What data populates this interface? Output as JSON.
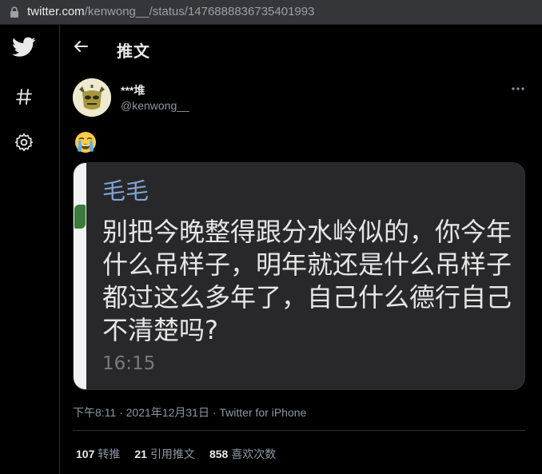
{
  "browser": {
    "url_domain": "twitter.com",
    "url_path": "/kenwong__/status/1476888836735401993",
    "lock_icon": "lock-icon"
  },
  "nav": {
    "items": [
      {
        "icon": "twitter-bird-icon"
      },
      {
        "icon": "hashtag-icon"
      },
      {
        "icon": "gear-icon"
      }
    ]
  },
  "header": {
    "back_icon": "arrow-left-icon",
    "title": "推文"
  },
  "tweet": {
    "display_name": "***堆",
    "handle": "@kenwong__",
    "more_icon": "more-dots-icon",
    "emoji": "😭",
    "media": {
      "sender": "毛毛",
      "lines": [
        "别把今晚整得跟分水岭似的，你今年",
        "什么吊样子，明年就还是什么吊样子",
        "都过这么多年了，自己什么德行自己",
        "不清楚吗?"
      ],
      "time": "16:15"
    },
    "timestamp": "下午8:11 · 2021年12月31日 · Twitter for iPhone",
    "stats": {
      "retweets_count": "107",
      "retweets_label": "转推",
      "quotes_count": "21",
      "quotes_label": "引用推文",
      "likes_count": "858",
      "likes_label": "喜欢次数"
    }
  },
  "colors": {
    "background": "#000000",
    "chat_bubble": "#28282a",
    "sender_blue": "#7fa4d6",
    "muted": "#8b98a5"
  }
}
